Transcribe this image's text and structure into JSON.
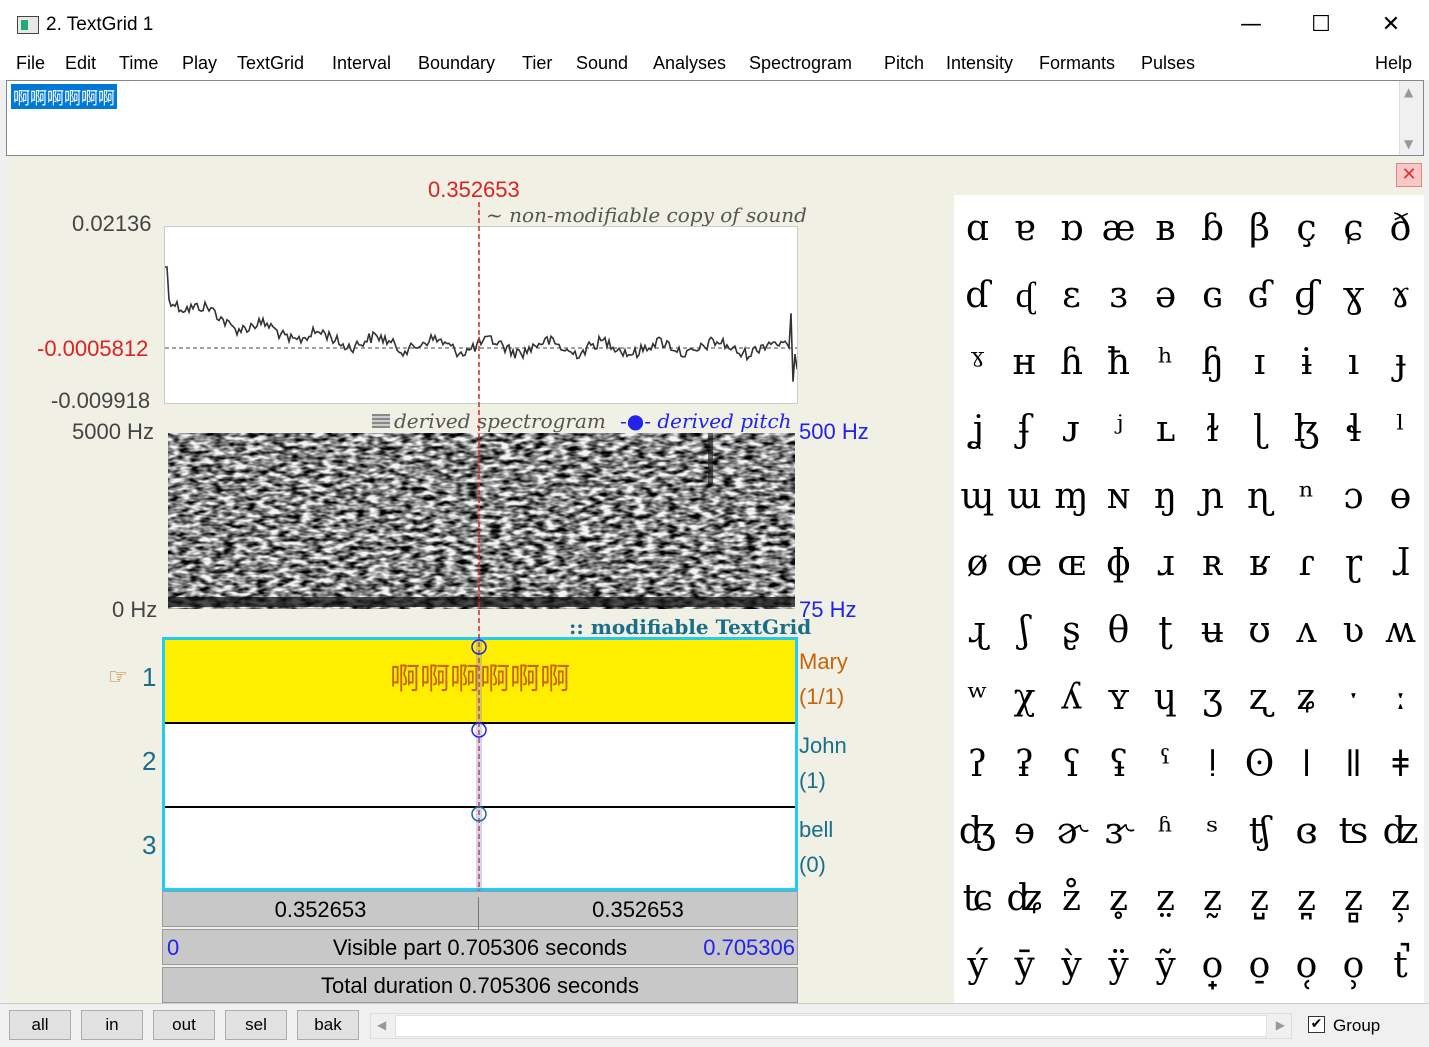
{
  "window": {
    "title": "2. TextGrid 1",
    "minimize_glyph": "—",
    "maximize_glyph": "☐",
    "close_glyph": "✕"
  },
  "menu": [
    "File",
    "Edit",
    "Time",
    "Play",
    "TextGrid",
    "Interval",
    "Boundary",
    "Tier",
    "Sound",
    "Analyses",
    "Spectrogram",
    "Pitch",
    "Intensity",
    "Formants",
    "Pulses",
    "Help"
  ],
  "text_field": {
    "selected_text": "啊啊啊啊啊啊"
  },
  "cursor": {
    "time": "0.352653"
  },
  "waveform": {
    "caption": "~ non-modifiable copy of sound",
    "y_max": "0.02136",
    "y_cursor": "-0.0005812",
    "y_min": "-0.009918"
  },
  "spectrogram": {
    "caption_spectrogram": "derived spectrogram",
    "caption_pitch": "derived pitch",
    "freq_max": "5000 Hz",
    "freq_min": "0 Hz",
    "pitch_max": "500 Hz",
    "pitch_min": "75 Hz"
  },
  "textgrid": {
    "caption": ":: modifiable TextGrid",
    "selected_tier_marker": "☞",
    "tiers": [
      {
        "number": "1",
        "name": "Mary",
        "count": "(1/1)",
        "text": "啊啊啊啊啊啊"
      },
      {
        "number": "2",
        "name": "John",
        "count": "(1)",
        "text": ""
      },
      {
        "number": "3",
        "name": "bell",
        "count": "(0)",
        "text": ""
      }
    ]
  },
  "time_bars": {
    "left_segment": "0.352653",
    "right_segment": "0.352653",
    "visible_start": "0",
    "visible_label": "Visible part 0.705306 seconds",
    "visible_end": "0.705306",
    "total_label": "Total duration 0.705306 seconds"
  },
  "ipa_chart": {
    "close_glyph": "✕",
    "rows": [
      [
        "ɑ",
        "ɐ",
        "ɒ",
        "æ",
        "ʙ",
        "ɓ",
        "β",
        "ç",
        "ɕ",
        "ð"
      ],
      [
        "ɗ",
        "ᶑ",
        "ɛ",
        "ɜ",
        "ə",
        "ɢ",
        "ʛ",
        "ɠ",
        "ɣ",
        "ɤ"
      ],
      [
        "ˠ",
        "ʜ",
        "ɦ",
        "ħ",
        "ʰ",
        "ɧ",
        "ɪ",
        "ɨ",
        "ı",
        "ɟ"
      ],
      [
        "ʝ",
        "ʄ",
        "ᴊ",
        "ʲ",
        "ʟ",
        "ɫ",
        "ɭ",
        "ɮ",
        "ɬ",
        "ˡ"
      ],
      [
        "ɰ",
        "ɯ",
        "ɱ",
        "ɴ",
        "ŋ",
        "ɲ",
        "ɳ",
        "ⁿ",
        "ɔ",
        "ɵ"
      ],
      [
        "ø",
        "œ",
        "ɶ",
        "ɸ",
        "ɹ",
        "ʀ",
        "ʁ",
        "ɾ",
        "ɽ",
        "ɺ"
      ],
      [
        "ɻ",
        "ʃ",
        "ʂ",
        "θ",
        "ʈ",
        "ʉ",
        "ʊ",
        "ʌ",
        "ʋ",
        "ʍ"
      ],
      [
        "ʷ",
        "χ",
        "ʎ",
        "ʏ",
        "ɥ",
        "ʒ",
        "ʐ",
        "ʑ",
        "ˑ",
        "ː"
      ],
      [
        "ʔ",
        "ʡ",
        "ʕ",
        "ʢ",
        "ˤ",
        "ǃ",
        "ʘ",
        "ǀ",
        "ǁ",
        "ǂ"
      ],
      [
        "ʤ",
        "ɘ",
        "ɚ",
        "ɝ",
        "ʱ",
        "ˢ",
        "ʧ",
        "ɞ",
        "ʦ",
        "ʣ"
      ],
      [
        "ʨ",
        "ʥ",
        "z̊",
        "z̥",
        "z̤",
        "z̰",
        "z̺",
        "z̪",
        "z̻",
        "z̹"
      ],
      [
        "ý",
        "ȳ",
        "ỳ",
        "ÿ",
        "ỹ",
        "o̟",
        "o̠",
        "o̜",
        "o̹",
        "t̚"
      ]
    ]
  },
  "bottom_bar": {
    "buttons": [
      "all",
      "in",
      "out",
      "sel",
      "bak"
    ],
    "group_label": "Group",
    "group_checked": true
  },
  "colors": {
    "cursor_red": "#dd2222",
    "tier_highlight": "#ffee00",
    "tier_border": "#22ccee",
    "pitch_blue": "#2222ee",
    "tier_name_orange": "#c8640a",
    "tier_name_teal": "#1b6e8a"
  }
}
